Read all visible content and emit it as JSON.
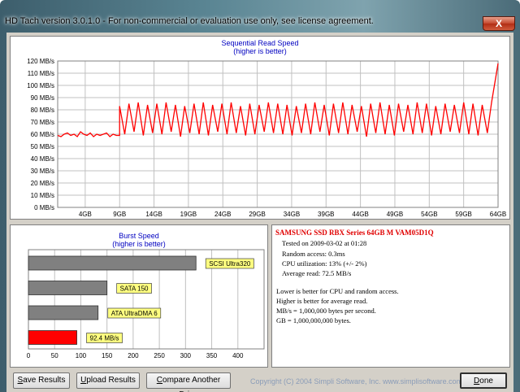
{
  "window": {
    "title": "HD Tach version 3.0.1.0  - For non-commercial or evaluation use only, see license agreement.",
    "close_glyph": "X"
  },
  "read_chart": {
    "title": "Sequential Read Speed",
    "subtitle": "(higher is better)",
    "line_color": "#ff0000",
    "y_ticks": [
      "120 MB/s",
      "110 MB/s",
      "100 MB/s",
      "90 MB/s",
      "80 MB/s",
      "70 MB/s",
      "60 MB/s",
      "50 MB/s",
      "40 MB/s",
      "30 MB/s",
      "20 MB/s",
      "10 MB/s",
      "0 MB/s"
    ],
    "x_ticks": [
      "4GB",
      "9GB",
      "14GB",
      "19GB",
      "24GB",
      "29GB",
      "34GB",
      "39GB",
      "44GB",
      "49GB",
      "54GB",
      "59GB",
      "64GB"
    ]
  },
  "burst_chart": {
    "title": "Burst Speed",
    "subtitle": "(higher is better)",
    "x_ticks": [
      "0",
      "50",
      "100",
      "150",
      "200",
      "250",
      "300",
      "350",
      "400"
    ]
  },
  "chart_data": [
    {
      "type": "line",
      "title": "Sequential Read Speed",
      "subtitle": "(higher is better)",
      "xlabel": "",
      "ylabel": "",
      "ylim": [
        0,
        120
      ],
      "xlim": [
        0,
        64
      ],
      "grid": true,
      "series": [
        {
          "name": "",
          "pattern_note_free": true,
          "segment_1": {
            "x_range": [
              0,
              9
            ],
            "values_mb_s": [
              59,
              58,
              60,
              61,
              59,
              60,
              58,
              62,
              60,
              59,
              61,
              58,
              60,
              59,
              60,
              61,
              58,
              60,
              59,
              59
            ]
          },
          "segment_2": {
            "x_range": [
              9,
              64
            ],
            "peak_mb_s": [
              83,
              85,
              86,
              84,
              85,
              86,
              84,
              83,
              85,
              86,
              84,
              85,
              86,
              83,
              85,
              84,
              86,
              85,
              84,
              83,
              85,
              86,
              84,
              85,
              86,
              84,
              83,
              85,
              86,
              84,
              85,
              84,
              86,
              85,
              83,
              85,
              84,
              86,
              85,
              84,
              86
            ],
            "trough_mb_s": [
              60,
              62,
              59,
              61,
              60,
              62,
              58,
              61,
              60,
              59,
              62,
              60,
              61,
              59,
              60,
              62,
              61,
              60,
              59,
              61,
              60,
              62,
              59,
              61,
              60,
              62,
              58,
              61,
              60,
              59,
              62,
              60,
              61,
              59,
              60,
              62,
              61,
              60,
              59,
              61
            ]
          },
          "end_spike_mb_s": 118
        }
      ]
    },
    {
      "type": "bar",
      "title": "Burst Speed",
      "subtitle": "(higher is better)",
      "xlim": [
        0,
        450
      ],
      "categories": [
        "SCSI Ultra320",
        "SATA 150",
        "ATA UltraDMA 6",
        "92.4 MB/s"
      ],
      "values": [
        320,
        150,
        133,
        92.4
      ],
      "colors": [
        "#808080",
        "#808080",
        "#808080",
        "#ff0000"
      ]
    }
  ],
  "info": {
    "drive_name": "SAMSUNG SSD RBX Series 64GB M VAM05D1Q",
    "tested_on": "Tested on 2009-03-02 at 01:28",
    "random_access": "Random access: 0.3ms",
    "cpu_utilization": "CPU utilization: 13% (+/- 2%)",
    "average_read": "Average read: 72.5 MB/s",
    "note_1": "Lower is better for CPU and random access.",
    "note_2": "Higher is better for average read.",
    "note_3": "MB/s = 1,000,000 bytes per second.",
    "note_4": "GB = 1,000,000,000 bytes."
  },
  "buttons": {
    "save": {
      "first": "S",
      "rest": "ave Results"
    },
    "upload": {
      "first": "U",
      "rest": "pload Results"
    },
    "compare": {
      "first": "C",
      "rest": "ompare Another Drive"
    },
    "done": {
      "first": "D",
      "rest": "one"
    }
  },
  "copyright": "Copyright (C) 2004 Simpli Software, Inc. www.simplisoftware.com"
}
